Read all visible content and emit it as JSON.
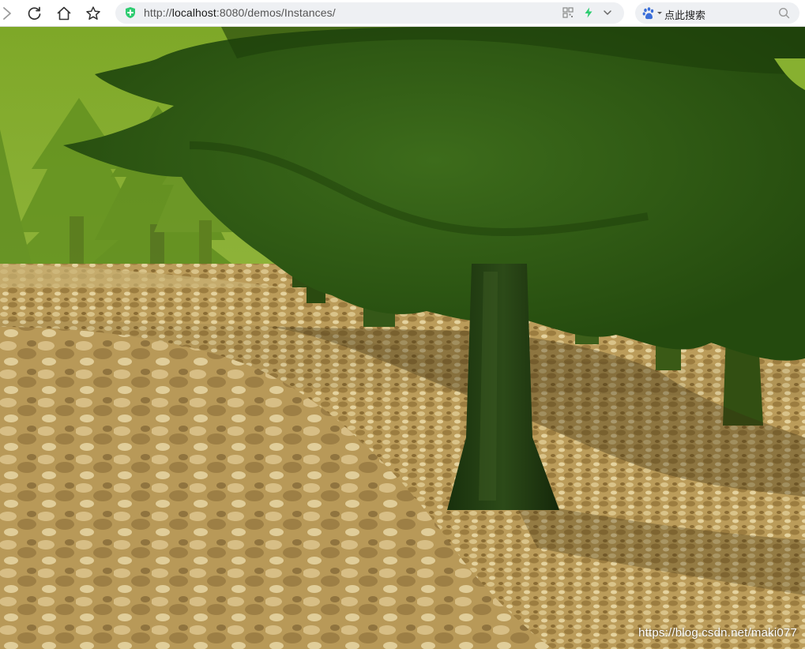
{
  "browser": {
    "url_scheme": "http://",
    "url_host": "localhost",
    "url_rest": ":8080/demos/Instances/",
    "search_placeholder": "点此搜索",
    "accent_color": "#2ecc71",
    "search_engine_icon": "baidu-paw-icon"
  },
  "scene": {
    "description_type": "webgl-canvas",
    "sky_color": "#86ad2e",
    "ground_color": "#b89a5a",
    "foliage_color": "#2f5a12",
    "trunk_color": "#223b12"
  },
  "watermark": "https://blog.csdn.net/maki077"
}
